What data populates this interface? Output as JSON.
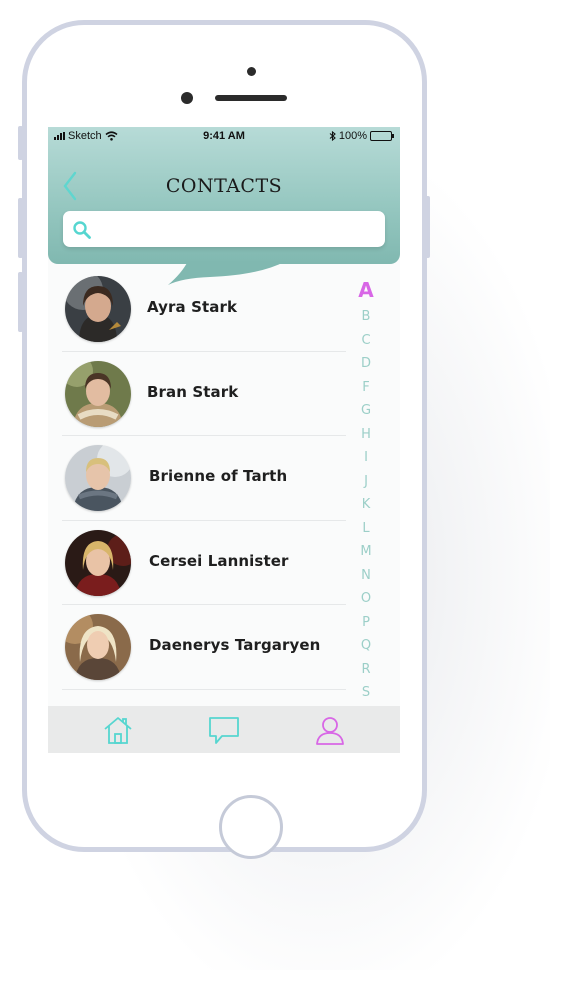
{
  "status_bar": {
    "carrier": "Sketch",
    "time": "9:41 AM",
    "battery": "100%"
  },
  "header": {
    "title": "CONTACTS"
  },
  "search": {
    "value": "",
    "placeholder": ""
  },
  "contacts": [
    {
      "name": "Ayra Stark"
    },
    {
      "name": "Bran Stark"
    },
    {
      "name": "Brienne of Tarth"
    },
    {
      "name": "Cersei Lannister"
    },
    {
      "name": "Daenerys Targaryen"
    }
  ],
  "alphabet_index": {
    "active": "A",
    "letters": [
      "A",
      "B",
      "C",
      "D",
      "F",
      "G",
      "H",
      "I",
      "J",
      "K",
      "L",
      "M",
      "N",
      "O",
      "P",
      "Q",
      "R",
      "S"
    ]
  },
  "tab_bar": {
    "items": [
      {
        "icon": "home-icon",
        "active": false
      },
      {
        "icon": "chat-icon",
        "active": false
      },
      {
        "icon": "profile-icon",
        "active": true
      }
    ]
  },
  "colors": {
    "accent": "#56d6d0",
    "active": "#d867e6",
    "header_top": "#b7dbd7",
    "header_bottom": "#80b8b0",
    "index_letters": "#9ccfc8"
  }
}
